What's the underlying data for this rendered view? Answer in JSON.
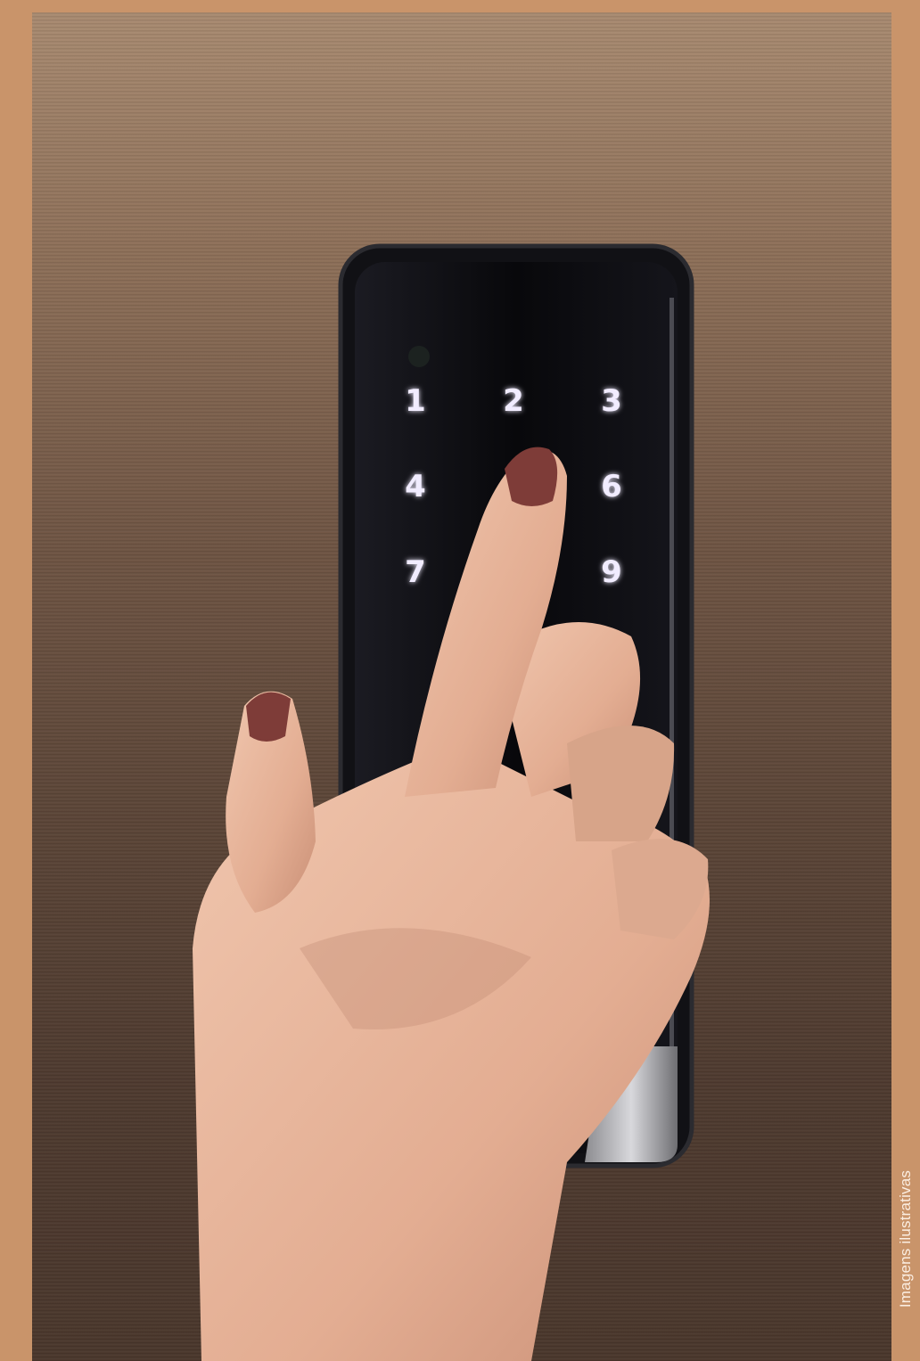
{
  "caption": "Imagens ilustrativas",
  "keypad": {
    "keys": [
      {
        "label": "1",
        "visible": true
      },
      {
        "label": "2",
        "visible": true
      },
      {
        "label": "3",
        "visible": true
      },
      {
        "label": "4",
        "visible": true
      },
      {
        "label": "",
        "visible": false
      },
      {
        "label": "6",
        "visible": true
      },
      {
        "label": "7",
        "visible": true
      },
      {
        "label": "",
        "visible": false
      },
      {
        "label": "9",
        "visible": true
      }
    ]
  },
  "colors": {
    "border": "#c9946a",
    "wood": "#6e5443",
    "lock_body": "#0e0e12",
    "key_glow": "#c8b8ff",
    "skin": "#e8b9a2",
    "nail": "#7e3c38"
  }
}
